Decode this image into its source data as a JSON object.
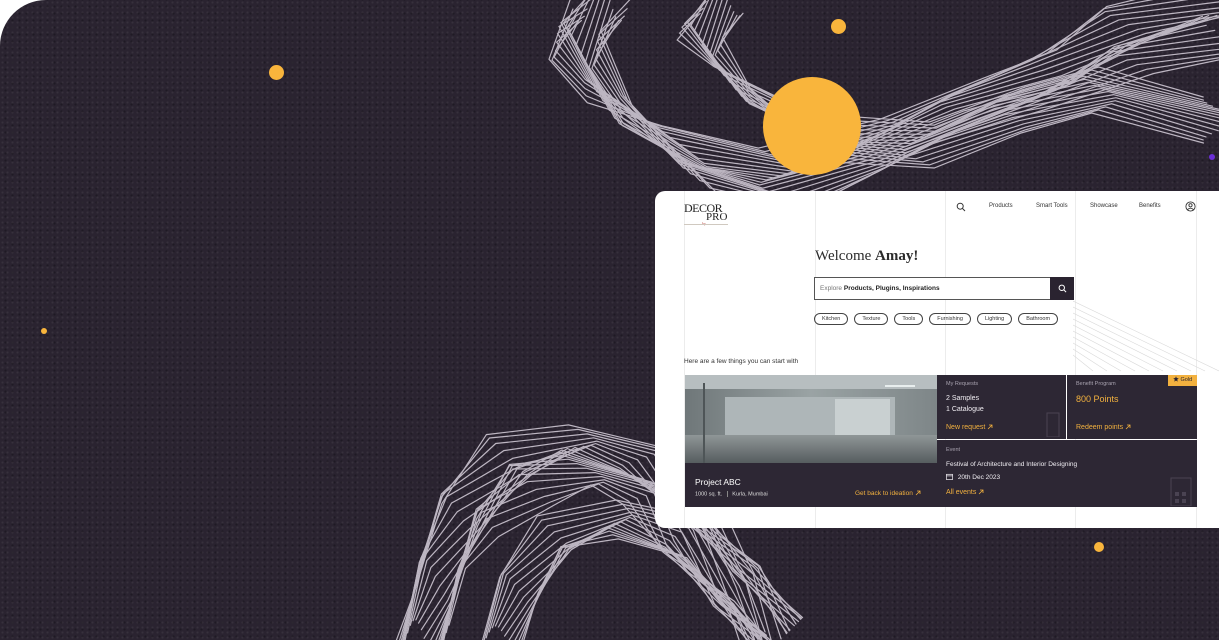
{
  "brand": {
    "logo_line1": "DECOR",
    "logo_line2": "PRO",
    "logo_tag": "by"
  },
  "nav": {
    "products": "Products",
    "smart_tools": "Smart Tools",
    "showcase": "Showcase",
    "benefits": "Benefits"
  },
  "welcome": {
    "prefix": "Welcome",
    "name": "Amay!"
  },
  "search": {
    "prefix": "Explore",
    "bold": "Products, Plugins, Inspirations"
  },
  "tags": [
    "Kitchen",
    "Texture",
    "Tools",
    "Furnishing",
    "Lighting",
    "Bathroom"
  ],
  "intro": "Here are a few things you can start with",
  "project": {
    "title": "Project ABC",
    "area": "1000 sq. ft.",
    "location": "Kurla, Mumbai",
    "link": "Get back to ideation"
  },
  "requests": {
    "label": "My Requests",
    "line1": "2 Samples",
    "line2": "1 Catalogue",
    "link": "New request"
  },
  "benefit": {
    "label": "Benefit Program",
    "points": "800 Points",
    "link": "Redeem points",
    "badge": "Gold"
  },
  "event": {
    "label": "Event",
    "title": "Festival of Architecture and Interior Designing",
    "date": "20th Dec 2023",
    "link": "All events"
  },
  "icons": [
    "search-icon",
    "user-icon",
    "arrow-up-right-icon",
    "calendar-icon",
    "star-icon"
  ],
  "colors": {
    "accent": "#f2b13f",
    "dark": "#2d2734",
    "background": "#2a2330",
    "wave": "#bdb6c2",
    "sun": "#f9b53c"
  }
}
